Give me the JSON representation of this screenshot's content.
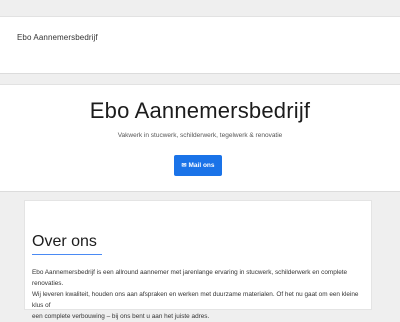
{
  "navbar": {
    "brand": "Ebo Aannemersbedrijf"
  },
  "hero": {
    "title": "Ebo Aannemersbedrijf",
    "subtitle": "Vakwerk in stucwerk, schilderwerk, tegelwerk & renovatie",
    "mail_icon": "✉",
    "mail_button_label": "Mail ons"
  },
  "about": {
    "title": "Over ons",
    "line1": "Ebo Aannemersbedrijf is een allround aannemer met jarenlange ervaring in stucwerk, schilderwerk en complete renovaties.",
    "line2": "Wij leveren kwaliteit, houden ons aan afspraken en werken met duurzame materialen. Of het nu gaat om een kleine klus of",
    "line3": "een complete verbouwing – bij ons bent u aan het juiste adres."
  },
  "colors": {
    "accent": "#1a73e8",
    "underline": "#4a8af4",
    "background": "#efefef"
  },
  "icons": {
    "mail": "envelope-icon"
  }
}
